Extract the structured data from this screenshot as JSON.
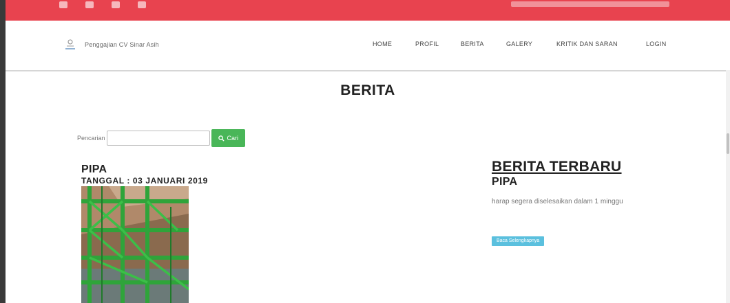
{
  "brand": {
    "name": "Penggajian CV Sinar Asih",
    "logo_icon": "company-logo-icon"
  },
  "nav": {
    "items": [
      {
        "label": "HOME"
      },
      {
        "label": "PROFIL"
      },
      {
        "label": "BERITA"
      },
      {
        "label": "GALERY"
      },
      {
        "label": "KRITIK DAN SARAN"
      },
      {
        "label": "LOGIN"
      }
    ]
  },
  "page": {
    "title": "BERITA"
  },
  "search": {
    "label": "Pencarian",
    "value": "",
    "button_label": "Cari",
    "button_icon": "search-icon"
  },
  "post": {
    "title": "PIPA",
    "date": "TANGGAL : 03 JANUARI 2019"
  },
  "latest": {
    "heading": "BERITA TERBARU",
    "title": "PIPA",
    "snippet": "harap segera diselesaikan dalam 1 minggu",
    "button_label": "Baca Selengkapnya"
  },
  "colors": {
    "topbar": "#e8434f",
    "search_button": "#49b658",
    "read_more_button": "#5bc0de"
  }
}
